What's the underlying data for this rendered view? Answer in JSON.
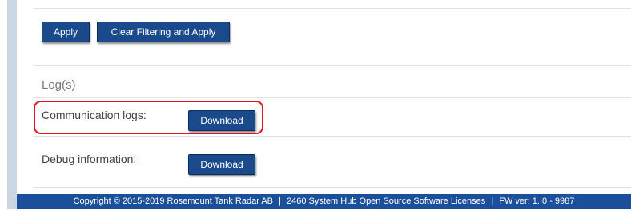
{
  "filter_actions": {
    "apply_label": "Apply",
    "clear_label": "Clear Filtering and Apply"
  },
  "logs": {
    "title": "Log(s)",
    "communication": {
      "label": "Communication logs:",
      "button_label": "Download"
    },
    "debug": {
      "label": "Debug information:",
      "button_label": "Download"
    }
  },
  "footer": {
    "copyright": "Copyright © 2015-2019 Rosemount Tank Radar AB",
    "separator1": "|",
    "licenses_link": "2460 System Hub Open Source Software Licenses",
    "separator2": "|",
    "fw_version": "FW ver: 1.I0 - 9987"
  },
  "colors": {
    "button_bg": "#1a4a8c",
    "footer_bg": "#1b4f99",
    "highlight_border": "#e8141b",
    "left_bar": "#ccd7e6"
  }
}
